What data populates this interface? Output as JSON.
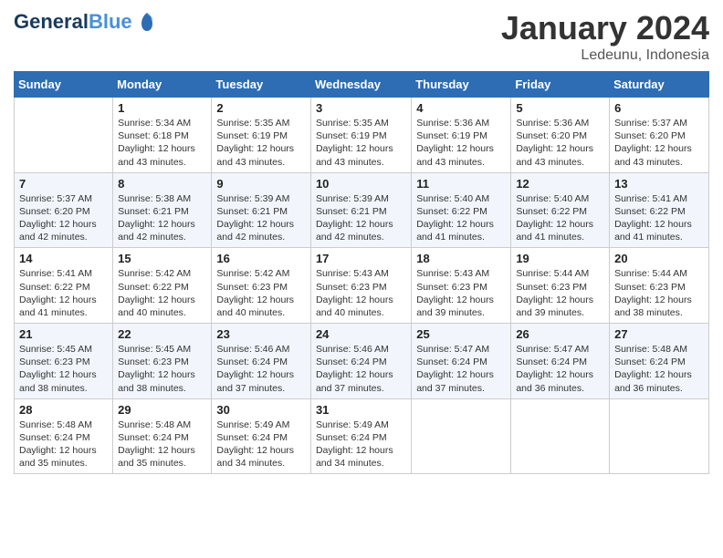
{
  "header": {
    "logo_line1": "General",
    "logo_line2": "Blue",
    "month": "January 2024",
    "location": "Ledeunu, Indonesia"
  },
  "days_of_week": [
    "Sunday",
    "Monday",
    "Tuesday",
    "Wednesday",
    "Thursday",
    "Friday",
    "Saturday"
  ],
  "weeks": [
    [
      {
        "day": "",
        "sunrise": "",
        "sunset": "",
        "daylight": ""
      },
      {
        "day": "1",
        "sunrise": "Sunrise: 5:34 AM",
        "sunset": "Sunset: 6:18 PM",
        "daylight": "Daylight: 12 hours and 43 minutes."
      },
      {
        "day": "2",
        "sunrise": "Sunrise: 5:35 AM",
        "sunset": "Sunset: 6:19 PM",
        "daylight": "Daylight: 12 hours and 43 minutes."
      },
      {
        "day": "3",
        "sunrise": "Sunrise: 5:35 AM",
        "sunset": "Sunset: 6:19 PM",
        "daylight": "Daylight: 12 hours and 43 minutes."
      },
      {
        "day": "4",
        "sunrise": "Sunrise: 5:36 AM",
        "sunset": "Sunset: 6:19 PM",
        "daylight": "Daylight: 12 hours and 43 minutes."
      },
      {
        "day": "5",
        "sunrise": "Sunrise: 5:36 AM",
        "sunset": "Sunset: 6:20 PM",
        "daylight": "Daylight: 12 hours and 43 minutes."
      },
      {
        "day": "6",
        "sunrise": "Sunrise: 5:37 AM",
        "sunset": "Sunset: 6:20 PM",
        "daylight": "Daylight: 12 hours and 43 minutes."
      }
    ],
    [
      {
        "day": "7",
        "sunrise": "Sunrise: 5:37 AM",
        "sunset": "Sunset: 6:20 PM",
        "daylight": "Daylight: 12 hours and 42 minutes."
      },
      {
        "day": "8",
        "sunrise": "Sunrise: 5:38 AM",
        "sunset": "Sunset: 6:21 PM",
        "daylight": "Daylight: 12 hours and 42 minutes."
      },
      {
        "day": "9",
        "sunrise": "Sunrise: 5:39 AM",
        "sunset": "Sunset: 6:21 PM",
        "daylight": "Daylight: 12 hours and 42 minutes."
      },
      {
        "day": "10",
        "sunrise": "Sunrise: 5:39 AM",
        "sunset": "Sunset: 6:21 PM",
        "daylight": "Daylight: 12 hours and 42 minutes."
      },
      {
        "day": "11",
        "sunrise": "Sunrise: 5:40 AM",
        "sunset": "Sunset: 6:22 PM",
        "daylight": "Daylight: 12 hours and 41 minutes."
      },
      {
        "day": "12",
        "sunrise": "Sunrise: 5:40 AM",
        "sunset": "Sunset: 6:22 PM",
        "daylight": "Daylight: 12 hours and 41 minutes."
      },
      {
        "day": "13",
        "sunrise": "Sunrise: 5:41 AM",
        "sunset": "Sunset: 6:22 PM",
        "daylight": "Daylight: 12 hours and 41 minutes."
      }
    ],
    [
      {
        "day": "14",
        "sunrise": "Sunrise: 5:41 AM",
        "sunset": "Sunset: 6:22 PM",
        "daylight": "Daylight: 12 hours and 41 minutes."
      },
      {
        "day": "15",
        "sunrise": "Sunrise: 5:42 AM",
        "sunset": "Sunset: 6:22 PM",
        "daylight": "Daylight: 12 hours and 40 minutes."
      },
      {
        "day": "16",
        "sunrise": "Sunrise: 5:42 AM",
        "sunset": "Sunset: 6:23 PM",
        "daylight": "Daylight: 12 hours and 40 minutes."
      },
      {
        "day": "17",
        "sunrise": "Sunrise: 5:43 AM",
        "sunset": "Sunset: 6:23 PM",
        "daylight": "Daylight: 12 hours and 40 minutes."
      },
      {
        "day": "18",
        "sunrise": "Sunrise: 5:43 AM",
        "sunset": "Sunset: 6:23 PM",
        "daylight": "Daylight: 12 hours and 39 minutes."
      },
      {
        "day": "19",
        "sunrise": "Sunrise: 5:44 AM",
        "sunset": "Sunset: 6:23 PM",
        "daylight": "Daylight: 12 hours and 39 minutes."
      },
      {
        "day": "20",
        "sunrise": "Sunrise: 5:44 AM",
        "sunset": "Sunset: 6:23 PM",
        "daylight": "Daylight: 12 hours and 38 minutes."
      }
    ],
    [
      {
        "day": "21",
        "sunrise": "Sunrise: 5:45 AM",
        "sunset": "Sunset: 6:23 PM",
        "daylight": "Daylight: 12 hours and 38 minutes."
      },
      {
        "day": "22",
        "sunrise": "Sunrise: 5:45 AM",
        "sunset": "Sunset: 6:23 PM",
        "daylight": "Daylight: 12 hours and 38 minutes."
      },
      {
        "day": "23",
        "sunrise": "Sunrise: 5:46 AM",
        "sunset": "Sunset: 6:24 PM",
        "daylight": "Daylight: 12 hours and 37 minutes."
      },
      {
        "day": "24",
        "sunrise": "Sunrise: 5:46 AM",
        "sunset": "Sunset: 6:24 PM",
        "daylight": "Daylight: 12 hours and 37 minutes."
      },
      {
        "day": "25",
        "sunrise": "Sunrise: 5:47 AM",
        "sunset": "Sunset: 6:24 PM",
        "daylight": "Daylight: 12 hours and 37 minutes."
      },
      {
        "day": "26",
        "sunrise": "Sunrise: 5:47 AM",
        "sunset": "Sunset: 6:24 PM",
        "daylight": "Daylight: 12 hours and 36 minutes."
      },
      {
        "day": "27",
        "sunrise": "Sunrise: 5:48 AM",
        "sunset": "Sunset: 6:24 PM",
        "daylight": "Daylight: 12 hours and 36 minutes."
      }
    ],
    [
      {
        "day": "28",
        "sunrise": "Sunrise: 5:48 AM",
        "sunset": "Sunset: 6:24 PM",
        "daylight": "Daylight: 12 hours and 35 minutes."
      },
      {
        "day": "29",
        "sunrise": "Sunrise: 5:48 AM",
        "sunset": "Sunset: 6:24 PM",
        "daylight": "Daylight: 12 hours and 35 minutes."
      },
      {
        "day": "30",
        "sunrise": "Sunrise: 5:49 AM",
        "sunset": "Sunset: 6:24 PM",
        "daylight": "Daylight: 12 hours and 34 minutes."
      },
      {
        "day": "31",
        "sunrise": "Sunrise: 5:49 AM",
        "sunset": "Sunset: 6:24 PM",
        "daylight": "Daylight: 12 hours and 34 minutes."
      },
      {
        "day": "",
        "sunrise": "",
        "sunset": "",
        "daylight": ""
      },
      {
        "day": "",
        "sunrise": "",
        "sunset": "",
        "daylight": ""
      },
      {
        "day": "",
        "sunrise": "",
        "sunset": "",
        "daylight": ""
      }
    ]
  ]
}
